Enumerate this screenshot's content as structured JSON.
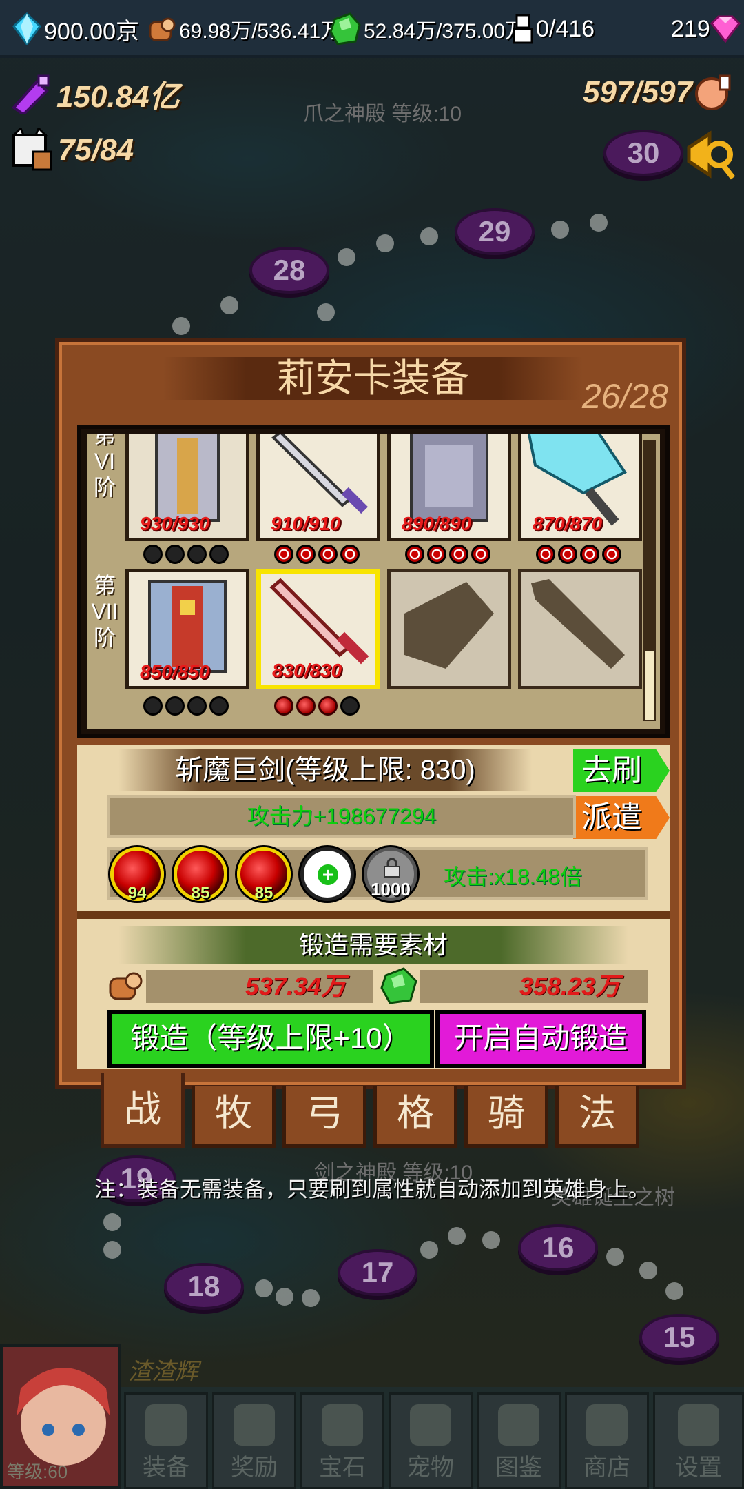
{
  "topbar": {
    "diamond": "900.00京",
    "wood": "69.98万/536.41万",
    "ore": "52.84万/375.00万",
    "population": "0/416",
    "gem": "219"
  },
  "stats": {
    "power": "150.84亿",
    "stamina": "597/597",
    "cat": "75/84"
  },
  "map": {
    "temple_top": "爪之神殿 等级:10",
    "temple_bottom": "剑之神殿 等级:10",
    "tree_label": "英雄诞生之树",
    "nodes": [
      "30",
      "29",
      "28",
      "19",
      "18",
      "17",
      "16",
      "15"
    ]
  },
  "panel": {
    "title": "莉安卡装备",
    "count": "26/28",
    "tiers": [
      {
        "label": [
          "第",
          "VI",
          "阶"
        ]
      },
      {
        "label": [
          "第",
          "VII",
          "阶"
        ]
      }
    ],
    "row1_levels": [
      "930/930",
      "910/910",
      "890/890",
      "870/870"
    ],
    "row2_levels": [
      "850/850",
      "830/830"
    ]
  },
  "detail": {
    "item_name": "斩魔巨剑(等级上限: 830)",
    "btn_refresh": "去刷",
    "btn_dispatch": "派遣",
    "attr": "攻击力+198677294",
    "gems": [
      "94",
      "85",
      "85"
    ],
    "lock_cost": "1000",
    "multiplier": "攻击:x18.48倍",
    "forge_title": "锻造需要素材",
    "mat_wood": "537.34万",
    "mat_ore": "358.23万",
    "btn_forge": "锻造（等级上限+10）",
    "btn_auto": "开启自动锻造"
  },
  "tabs": [
    "战",
    "牧",
    "弓",
    "格",
    "骑",
    "法"
  ],
  "note": "注：装备无需装备，只要刷到属性就自动添加到英雄身上。",
  "hero": {
    "name": "渣渣辉",
    "level": "等级:60"
  },
  "bottom_nav": [
    "装备",
    "奖励",
    "宝石",
    "宠物",
    "图鉴",
    "商店",
    "设置"
  ],
  "colors": {
    "panel": "#8a4a22",
    "forge_btn": "#2ad21f",
    "auto_btn": "#e21ad8",
    "refresh_btn": "#2ad21f",
    "dispatch_btn": "#f07a1a"
  }
}
